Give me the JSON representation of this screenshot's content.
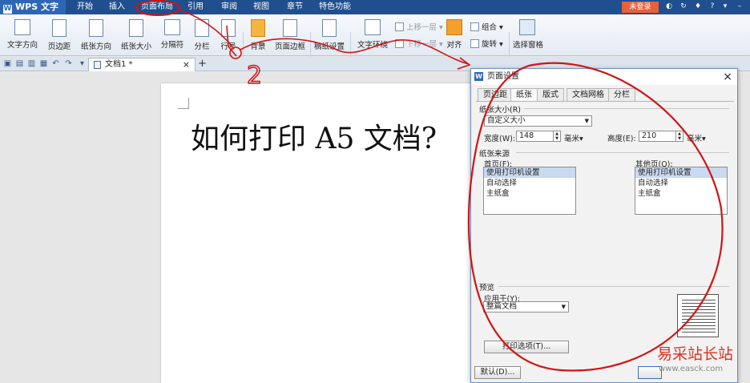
{
  "app": {
    "name": "WPS 文字",
    "logo_letter": "W"
  },
  "menu": {
    "tabs": [
      "开始",
      "插入",
      "页面布局",
      "引用",
      "审阅",
      "视图",
      "章节",
      "特色功能"
    ],
    "active_tab": "页面布局",
    "login_label": "未登录"
  },
  "ribbon": {
    "buttons": [
      "文字方向",
      "页边距",
      "纸张方向",
      "纸张大小",
      "分隔符",
      "分栏",
      "行号",
      "背景",
      "页面边框",
      "稿纸设置",
      "文字环绕",
      "对齐",
      "旋转",
      "选择窗格"
    ],
    "small": {
      "up_layer": "上移一层",
      "down_layer": "下移一层",
      "group": "组合"
    }
  },
  "document_tab": {
    "title": "文档1 *",
    "close": "×",
    "new_tab": "+"
  },
  "document": {
    "heading": "如何打印 A5 文档?"
  },
  "dialog": {
    "title": "页面设置",
    "close": "×",
    "tabs": [
      "页边距",
      "纸张",
      "版式",
      "文档网格",
      "分栏"
    ],
    "active_tab": "纸张",
    "paper_size_label": "纸张大小(R)",
    "paper_size_value": "自定义大小",
    "width_label": "宽度(W):",
    "width_value": "148",
    "width_unit": "毫米",
    "height_label": "高度(E):",
    "height_value": "210",
    "height_unit": "毫米",
    "source_label": "纸张来源",
    "first_page_label": "首页(F):",
    "other_pages_label": "其他页(O):",
    "first_page_options": [
      "使用打印机设置",
      "自动选择",
      "主纸盒"
    ],
    "other_pages_options": [
      "使用打印机设置",
      "自动选择",
      "主纸盒"
    ],
    "preview_label": "预览",
    "apply_to_label": "应用于(Y):",
    "apply_to_value": "整篇文档",
    "print_options_button": "打印选项(T)...",
    "default_button": "默认(D)..."
  },
  "annotation": {
    "step_number": "2",
    "color": "#d01414"
  },
  "watermark": {
    "text": "易采站长站",
    "url": "www.easck.com"
  }
}
